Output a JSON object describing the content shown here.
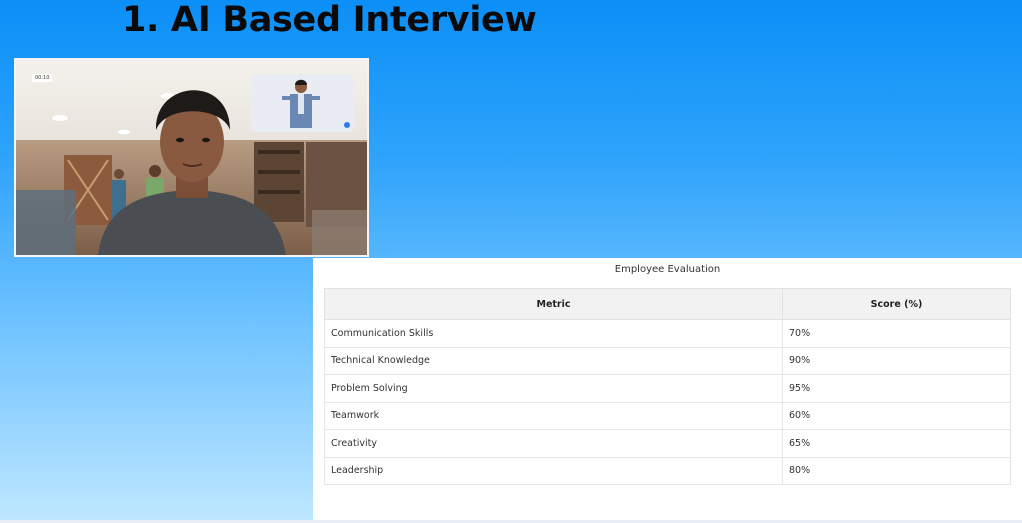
{
  "title": "1. AI Based Interview",
  "video": {
    "timer": "00:10"
  },
  "evaluation": {
    "caption": "Employee Evaluation",
    "columns": [
      "Metric",
      "Score (%)"
    ],
    "rows": [
      {
        "metric": "Communication Skills",
        "score": "70%"
      },
      {
        "metric": "Technical Knowledge",
        "score": "90%"
      },
      {
        "metric": "Problem Solving",
        "score": "95%"
      },
      {
        "metric": "Teamwork",
        "score": "60%"
      },
      {
        "metric": "Creativity",
        "score": "65%"
      },
      {
        "metric": "Leadership",
        "score": "80%"
      }
    ]
  },
  "colors": {
    "background_top": "#0b8ff7",
    "background_bottom": "#bfe7ff",
    "panel": "#ffffff",
    "header_row": "#f2f2f2",
    "pip_indicator": "#2f7bf6"
  },
  "icons": {
    "pip_indicator": "record-dot-icon"
  }
}
